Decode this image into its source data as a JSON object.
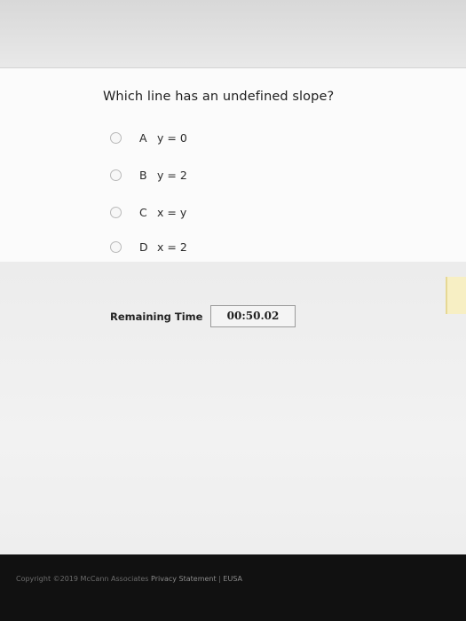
{
  "question": {
    "text": "Which line has an undefined slope?",
    "options": [
      {
        "letter": "A",
        "text": "y = 0"
      },
      {
        "letter": "B",
        "text": "y = 2"
      },
      {
        "letter": "C",
        "text": "x = y"
      },
      {
        "letter": "D",
        "text": "x = 2"
      }
    ]
  },
  "timer": {
    "label": "Remaining Time",
    "value": "00:50.02"
  },
  "footer": {
    "copyright": "Copyright ©2019 McCann Associates",
    "privacy_link": "Privacy Statement",
    "separator": "|",
    "eusa_link": "EUSA"
  },
  "colors": {
    "footer_background": "#111111",
    "card_background": "#fbfbfb"
  }
}
